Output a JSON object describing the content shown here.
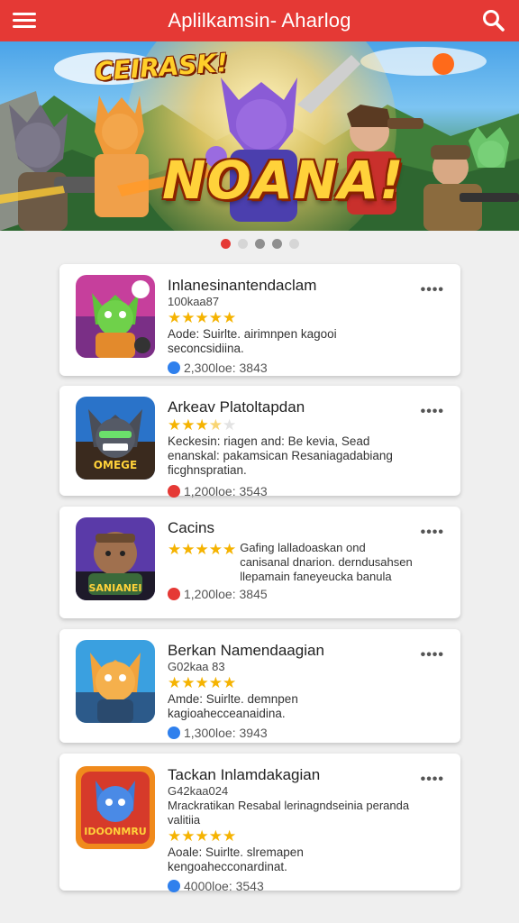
{
  "app_bar": {
    "title": "Aplilkamsin- Aharlog",
    "color": "#e53935"
  },
  "banner": {
    "top_text": "CEIRASK!",
    "main_text": "NOANA!"
  },
  "carousel": {
    "count": 5,
    "active_index": 0
  },
  "apps": [
    {
      "name": "Inlanesinantendaclam",
      "sub": "100kaa87",
      "rating": 5,
      "desc": "Aode: Suirlte. airimnpen kagooi seconcsidiina.",
      "meta": "2,300loe: 3843",
      "icon_text": "",
      "badge_color": "#2f80ed"
    },
    {
      "name": "Arkeav Platoltapdan",
      "sub": "",
      "rating": 3.5,
      "desc": "Keckesin: riagen and: Be kevia, Sead enanskal: pakamsican Resaniagadabiang ficghnspratian.",
      "meta": "1,200loe: 3543",
      "icon_text": "OMEGE",
      "badge_color": "#e53935"
    },
    {
      "name": "Cacins",
      "sub": "",
      "rating": 5,
      "desc": "Gafing lalladoaskan ond canisanal dnarion. derndusahsen llepamain faneyeucka banula",
      "meta": "1,200loe: 3845",
      "icon_text": "SANIANEI",
      "badge_color": "#e53935"
    },
    {
      "name": "Berkan Namendaagian",
      "sub": "G02kaa 83",
      "rating": 5,
      "desc": "Amde: Suirlte. demnpen kagioahecceanaidina.",
      "meta": "1,300loe: 3943",
      "icon_text": "",
      "badge_color": "#2f80ed"
    },
    {
      "name": "Tackan Inlamdakagian",
      "sub": "G42kaa024",
      "rating": 5,
      "desc": "Mrackratikan Resabal lerinagndseinia peranda valitiia",
      "desc2": "Aoale: Suirlte. slremapen kengoahecconardinat.",
      "meta": "4000loe: 3543",
      "icon_text": "IDOONMRU",
      "badge_color": "#2f80ed"
    }
  ]
}
